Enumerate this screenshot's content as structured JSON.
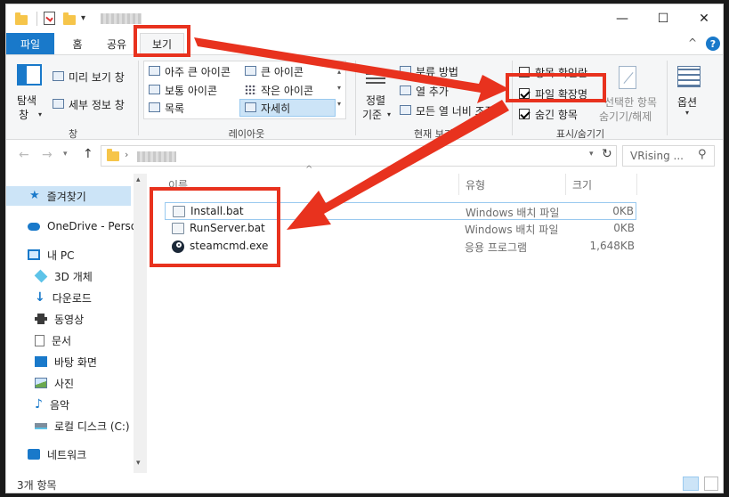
{
  "title_bar": {
    "minimize": "—",
    "maximize": "☐",
    "close": "✕"
  },
  "tabs": {
    "file": "파일",
    "home": "홈",
    "share": "공유",
    "view": "보기",
    "help": "?",
    "collapse": "^"
  },
  "ribbon": {
    "pane": {
      "nav_pane_l1": "탐색",
      "nav_pane_l2": "창",
      "preview": "미리 보기 창",
      "details": "세부 정보 창",
      "label": "창"
    },
    "layout": {
      "extra_large": "아주 큰 아이콘",
      "large": "큰 아이콘",
      "medium": "보통 아이콘",
      "small": "작은 아이콘",
      "list": "목록",
      "details": "자세히",
      "label": "레이아웃"
    },
    "current_view": {
      "sort_l1": "정렬",
      "sort_l2": "기준",
      "group_by": "분류 방법",
      "add_columns": "열 추가",
      "size_all": "모든 열 너비 조정",
      "label": "현재 보기"
    },
    "show_hide": {
      "item_checkboxes": "항목 확인란",
      "file_extensions": "파일 확장명",
      "hidden_items": "숨긴 항목",
      "hide_selected_l1": "선택한 항목",
      "hide_selected_l2": "숨기기/해제",
      "label": "표시/숨기기"
    },
    "options": {
      "label": "옵션"
    }
  },
  "address": {
    "search_placeholder": "VRising ..."
  },
  "nav": {
    "items": [
      {
        "label": "즐겨찾기"
      },
      {
        "label": "OneDrive - Person"
      },
      {
        "label": "내 PC"
      },
      {
        "label": "3D 개체"
      },
      {
        "label": "다운로드"
      },
      {
        "label": "동영상"
      },
      {
        "label": "문서"
      },
      {
        "label": "바탕 화면"
      },
      {
        "label": "사진"
      },
      {
        "label": "음악"
      },
      {
        "label": "로컬 디스크 (C:)"
      },
      {
        "label": "네트워크"
      }
    ]
  },
  "columns": {
    "name": "이름",
    "type": "유형",
    "size": "크기"
  },
  "files": [
    {
      "name": "Install.bat",
      "type": "Windows 배치 파일",
      "size": "0KB"
    },
    {
      "name": "RunServer.bat",
      "type": "Windows 배치 파일",
      "size": "0KB"
    },
    {
      "name": "steamcmd.exe",
      "type": "응용 프로그램",
      "size": "1,648KB"
    }
  ],
  "status": {
    "count": "3개 항목"
  },
  "colors": {
    "accent": "#1979ca",
    "annotation": "#e8321e"
  }
}
